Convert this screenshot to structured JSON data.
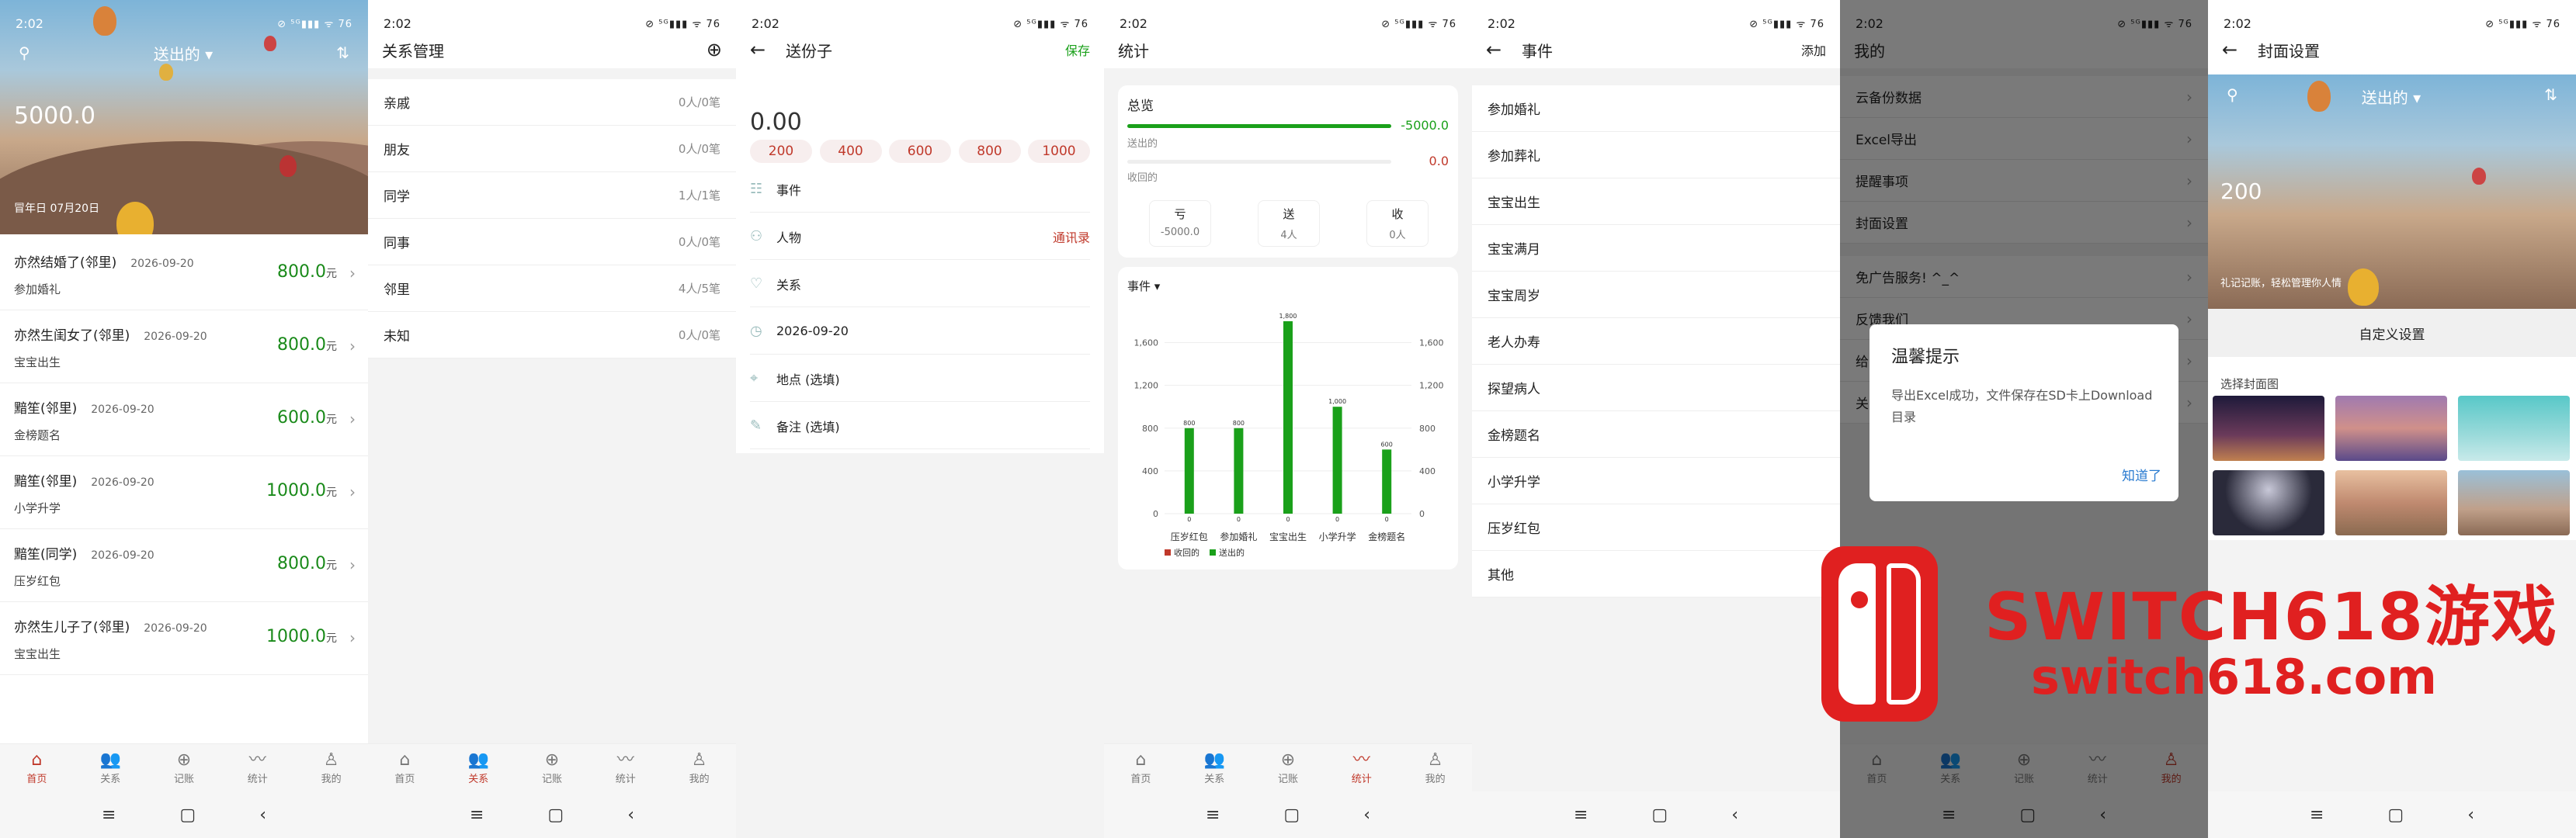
{
  "status": {
    "time": "2:02",
    "icons": "⊘ ⁵ᴳ▮▮▮ ᯤ 76"
  },
  "screen1": {
    "header_type": "送出的",
    "amount": "5000.0",
    "date_label": "冒年日 07月20日",
    "records": [
      {
        "title": "亦然结婚了(邻里)",
        "date": "2026-09-20",
        "sub": "参加婚礼",
        "amount": "800.0",
        "unit": "元"
      },
      {
        "title": "亦然生闺女了(邻里)",
        "date": "2026-09-20",
        "sub": "宝宝出生",
        "amount": "800.0",
        "unit": "元"
      },
      {
        "title": "黯笙(邻里)",
        "date": "2026-09-20",
        "sub": "金榜题名",
        "amount": "600.0",
        "unit": "元"
      },
      {
        "title": "黯笙(邻里)",
        "date": "2026-09-20",
        "sub": "小学升学",
        "amount": "1000.0",
        "unit": "元"
      },
      {
        "title": "黯笙(同学)",
        "date": "2026-09-20",
        "sub": "压岁红包",
        "amount": "800.0",
        "unit": "元"
      },
      {
        "title": "亦然生儿子了(邻里)",
        "date": "2026-09-20",
        "sub": "宝宝出生",
        "amount": "1000.0",
        "unit": "元"
      }
    ]
  },
  "nav": {
    "items": [
      "首页",
      "关系",
      "记账",
      "统计",
      "我的"
    ]
  },
  "screen2": {
    "title": "关系管理",
    "rows": [
      {
        "name": "亲戚",
        "count": "0人/0笔"
      },
      {
        "name": "朋友",
        "count": "0人/0笔"
      },
      {
        "name": "同学",
        "count": "1人/1笔"
      },
      {
        "name": "同事",
        "count": "0人/0笔"
      },
      {
        "name": "邻里",
        "count": "4人/5笔"
      },
      {
        "name": "未知",
        "count": "0人/0笔"
      }
    ]
  },
  "screen3": {
    "title": "送份子",
    "save": "保存",
    "amount": "0.00",
    "chips": [
      "200",
      "400",
      "600",
      "800",
      "1000"
    ],
    "fields": [
      {
        "label": "事件",
        "right": ""
      },
      {
        "label": "人物",
        "right": "通讯录"
      },
      {
        "label": "关系",
        "right": ""
      },
      {
        "label": "2026-09-20",
        "right": ""
      },
      {
        "label": "地点 (选填)",
        "right": ""
      },
      {
        "label": "备注 (选填)",
        "right": ""
      }
    ]
  },
  "screen4": {
    "title": "统计",
    "overview_label": "总览",
    "sent_label": "送出的",
    "sent_value": "-5000.0",
    "recv_label": "收回的",
    "recv_value": "0.0",
    "minis": [
      {
        "a": "亏",
        "b": "-5000.0"
      },
      {
        "a": "送",
        "b": "4人"
      },
      {
        "a": "收",
        "b": "0人"
      }
    ],
    "chart_selector": "事件",
    "legend": [
      "收回的",
      "送出的"
    ]
  },
  "chart_data": {
    "type": "bar",
    "categories": [
      "压岁红包",
      "参加婚礼",
      "宝宝出生",
      "小学升学",
      "金榜题名"
    ],
    "series": [
      {
        "name": "收回的",
        "values": [
          0,
          0,
          0,
          0,
          0
        ],
        "color": "#c0392b"
      },
      {
        "name": "送出的",
        "values": [
          800,
          800,
          1800,
          1000,
          600
        ],
        "color": "#1aa01a"
      }
    ],
    "y_ticks": [
      "0",
      "400",
      "800",
      "1,200",
      "1,600"
    ],
    "ylim": [
      0,
      1800
    ],
    "data_labels": [
      "800",
      "800",
      "1,800",
      "1,000",
      "600"
    ],
    "zero_labels": [
      "0",
      "0",
      "0",
      "0",
      "0"
    ]
  },
  "screen5": {
    "title": "事件",
    "action": "添加",
    "items": [
      "参加婚礼",
      "参加葬礼",
      "宝宝出生",
      "宝宝满月",
      "宝宝周岁",
      "老人办寿",
      "探望病人",
      "金榜题名",
      "小学升学",
      "压岁红包",
      "其他"
    ]
  },
  "screen6": {
    "title": "我的",
    "items": [
      "云备份数据",
      "Excel导出",
      "提醒事项",
      "封面设置",
      "免广告服务! ^_^",
      "反馈我们",
      "给",
      "关"
    ],
    "dialog": {
      "title": "温馨提示",
      "message": "导出Excel成功，文件保存在SD卡上Download目录",
      "button": "知道了"
    }
  },
  "screen7": {
    "title": "封面设置",
    "header_type": "送出的",
    "amount": "200",
    "hero_caption": "礼记记账，轻松管理你人情",
    "custom": "自定义设置",
    "choose": "选择封面图"
  },
  "watermark": {
    "line1": "SWITCH618游戏",
    "line2": "switch618.com"
  },
  "colors": {
    "accent": "#c0392b",
    "green": "#1aa01a"
  }
}
